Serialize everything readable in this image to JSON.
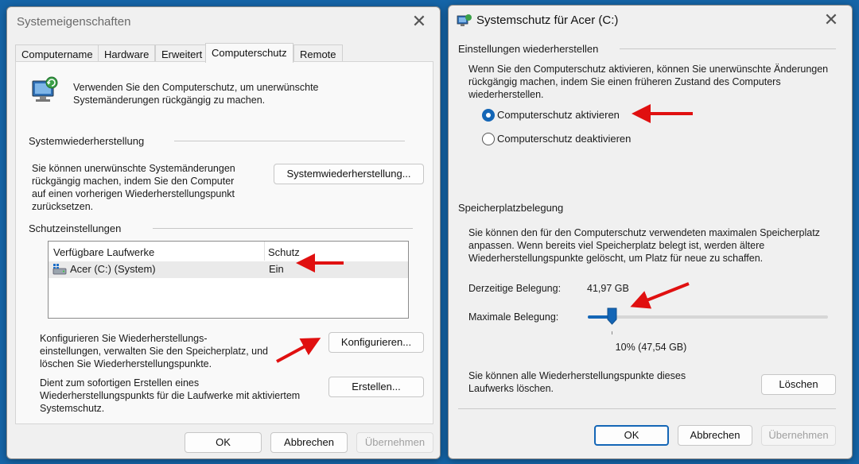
{
  "sysprops": {
    "title": "Systemeigenschaften",
    "tabs": [
      "Computername",
      "Hardware",
      "Erweitert",
      "Computerschutz",
      "Remote"
    ],
    "active_tab": "Computerschutz",
    "intro_line1": "Verwenden Sie den Computerschutz, um unerwünschte",
    "intro_line2": "Systemänderungen rückgängig zu machen.",
    "restore_group": "Systemwiederherstellung",
    "restore_text": [
      "Sie können unerwünschte Systemänderungen",
      "rückgängig machen, indem Sie den Computer",
      "auf einen vorherigen Wiederherstellungspunkt",
      "zurücksetzen."
    ],
    "restore_button": "Systemwiederherstellung...",
    "protection_group": "Schutzeinstellungen",
    "table": {
      "headers": [
        "Verfügbare Laufwerke",
        "Schutz"
      ],
      "rows": [
        {
          "drive": "Acer (C:) (System)",
          "protection": "Ein"
        }
      ]
    },
    "configure_text": [
      "Konfigurieren Sie Wiederherstellungs-",
      "einstellungen, verwalten Sie den Speicherplatz, und",
      "löschen Sie Wiederherstellungspunkte."
    ],
    "configure_button": "Konfigurieren...",
    "create_text": [
      "Dient zum sofortigen Erstellen eines",
      "Wiederherstellungspunkts für die Laufwerke mit aktiviertem",
      "Systemschutz."
    ],
    "create_button": "Erstellen...",
    "ok": "OK",
    "cancel": "Abbrechen",
    "apply": "Übernehmen"
  },
  "protect_dialog": {
    "title": "Systemschutz für Acer (C:)",
    "settings_group": "Einstellungen wiederherstellen",
    "settings_text": [
      "Wenn Sie den Computerschutz aktivieren, können Sie unerwünschte Änderungen",
      "rückgängig machen, indem Sie einen früheren Zustand des Computers",
      "wiederherstellen."
    ],
    "radio_on": "Computerschutz aktivieren",
    "radio_off": "Computerschutz deaktivieren",
    "selected": "Computerschutz aktivieren",
    "space_group": "Speicherplatzbelegung",
    "space_text": [
      "Sie können den für den Computerschutz verwendeten maximalen Speicherplatz",
      "anpassen. Wenn bereits viel Speicherplatz belegt ist, werden ältere",
      "Wiederherstellungspunkte gelöscht, um Platz für neue zu schaffen."
    ],
    "current_label": "Derzeitige Belegung:",
    "current_value": "41,97 GB",
    "max_label": "Maximale Belegung:",
    "max_percent": 10,
    "max_value_text": "10% (47,54 GB)",
    "delete_text": [
      "Sie können alle Wiederherstellungspunkte dieses",
      "Laufwerks löschen."
    ],
    "delete_button": "Löschen",
    "ok": "OK",
    "cancel": "Abbrechen",
    "apply": "Übernehmen"
  },
  "colors": {
    "accent": "#1466b6",
    "arrow": "#e01010",
    "desktop": "#1565a8"
  }
}
